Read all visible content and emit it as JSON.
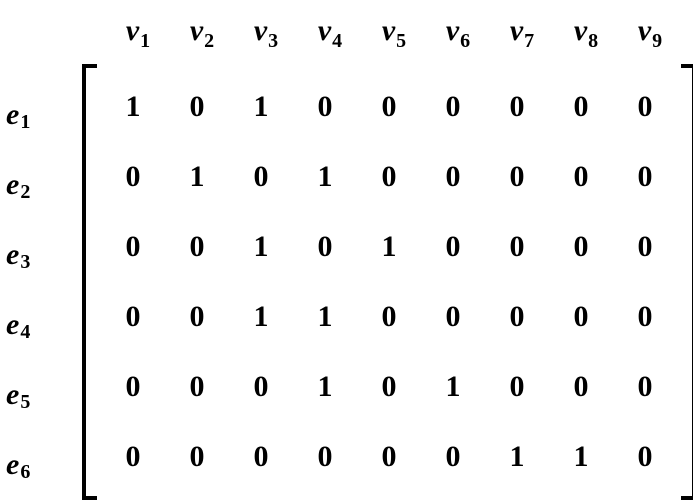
{
  "col_var": "v",
  "row_var": "e",
  "col_indices": [
    "1",
    "2",
    "3",
    "4",
    "5",
    "6",
    "7",
    "8",
    "9"
  ],
  "row_indices": [
    "1",
    "2",
    "3",
    "4",
    "5",
    "6"
  ],
  "chart_data": {
    "type": "table",
    "title": "",
    "columns": [
      "v1",
      "v2",
      "v3",
      "v4",
      "v5",
      "v6",
      "v7",
      "v8",
      "v9"
    ],
    "rows": [
      "e1",
      "e2",
      "e3",
      "e4",
      "e5",
      "e6"
    ],
    "values": [
      [
        1,
        0,
        1,
        0,
        0,
        0,
        0,
        0,
        0
      ],
      [
        0,
        1,
        0,
        1,
        0,
        0,
        0,
        0,
        0
      ],
      [
        0,
        0,
        1,
        0,
        1,
        0,
        0,
        0,
        0
      ],
      [
        0,
        0,
        1,
        1,
        0,
        0,
        0,
        0,
        0
      ],
      [
        0,
        0,
        0,
        1,
        0,
        1,
        0,
        0,
        0
      ],
      [
        0,
        0,
        0,
        0,
        0,
        0,
        1,
        1,
        0
      ]
    ]
  }
}
